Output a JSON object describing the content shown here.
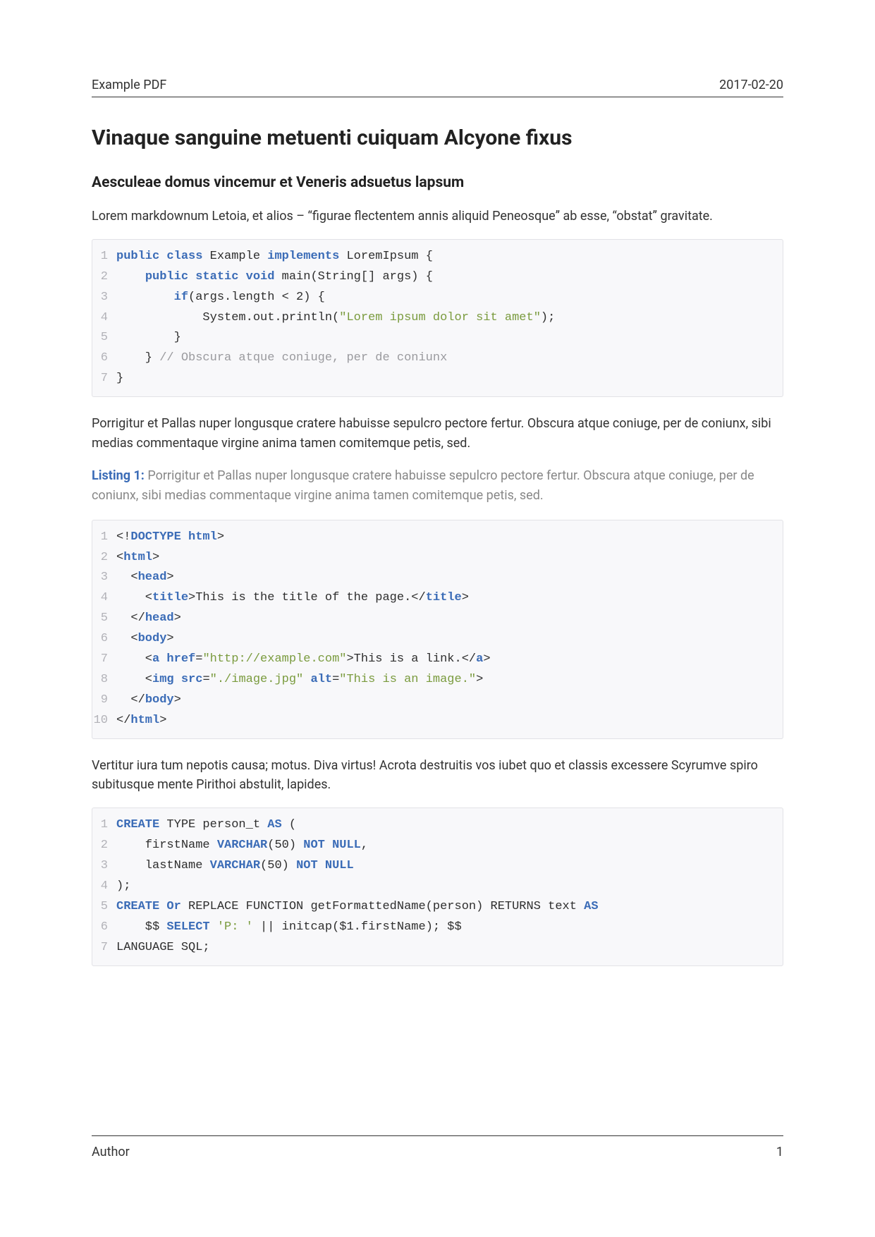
{
  "header": {
    "title": "Example PDF",
    "date": "2017-02-20"
  },
  "h1": "Vinaque sanguine metuenti cuiquam Alcyone fixus",
  "h2": "Aesculeae domus vincemur et Veneris adsuetus lapsum",
  "p1": "Lorem markdownum Letoia, et alios – “figurae flectentem annis aliquid Peneosque” ab esse, “obstat” gravitate.",
  "code1": {
    "lines": [
      [
        {
          "t": "public class",
          "c": "kw"
        },
        {
          "t": " Example ",
          "c": ""
        },
        {
          "t": "implements",
          "c": "kw"
        },
        {
          "t": " LoremIpsum {",
          "c": ""
        }
      ],
      [
        {
          "t": "    ",
          "c": ""
        },
        {
          "t": "public static void",
          "c": "kw"
        },
        {
          "t": " main(String[] args) {",
          "c": ""
        }
      ],
      [
        {
          "t": "        ",
          "c": ""
        },
        {
          "t": "if",
          "c": "kw"
        },
        {
          "t": "(args.length < 2) {",
          "c": ""
        }
      ],
      [
        {
          "t": "            System.out.println(",
          "c": ""
        },
        {
          "t": "\"Lorem ipsum dolor sit amet\"",
          "c": "str"
        },
        {
          "t": ");",
          "c": ""
        }
      ],
      [
        {
          "t": "        }",
          "c": ""
        }
      ],
      [
        {
          "t": "    } ",
          "c": ""
        },
        {
          "t": "// Obscura atque coniuge, per de coniunx",
          "c": "cmt"
        }
      ],
      [
        {
          "t": "}",
          "c": ""
        }
      ]
    ]
  },
  "p2": "Porrigitur et Pallas nuper longusque cratere habuisse sepulcro pectore fertur. Obscura atque coniuge, per de coniunx, sibi medias commentaque virgine anima tamen comitemque petis, sed.",
  "listing1": {
    "label": "Listing 1:",
    "caption": " Porrigitur et Pallas nuper longusque cratere habuisse sepulcro pectore fertur. Obscura atque coniuge, per de coniunx, sibi medias commentaque virgine anima tamen comitemque petis, sed."
  },
  "code2": {
    "lines": [
      [
        {
          "t": "<!",
          "c": ""
        },
        {
          "t": "DOCTYPE html",
          "c": "tagb"
        },
        {
          "t": ">",
          "c": ""
        }
      ],
      [
        {
          "t": "<",
          "c": ""
        },
        {
          "t": "html",
          "c": "tagb"
        },
        {
          "t": ">",
          "c": ""
        }
      ],
      [
        {
          "t": "  <",
          "c": ""
        },
        {
          "t": "head",
          "c": "tagb"
        },
        {
          "t": ">",
          "c": ""
        }
      ],
      [
        {
          "t": "    <",
          "c": ""
        },
        {
          "t": "title",
          "c": "tagb"
        },
        {
          "t": ">This is the title of the page.</",
          "c": ""
        },
        {
          "t": "title",
          "c": "tagb"
        },
        {
          "t": ">",
          "c": ""
        }
      ],
      [
        {
          "t": "  </",
          "c": ""
        },
        {
          "t": "head",
          "c": "tagb"
        },
        {
          "t": ">",
          "c": ""
        }
      ],
      [
        {
          "t": "  <",
          "c": ""
        },
        {
          "t": "body",
          "c": "tagb"
        },
        {
          "t": ">",
          "c": ""
        }
      ],
      [
        {
          "t": "    <",
          "c": ""
        },
        {
          "t": "a href",
          "c": "tagb"
        },
        {
          "t": "=",
          "c": ""
        },
        {
          "t": "\"http://example.com\"",
          "c": "attr"
        },
        {
          "t": ">This is a link.</",
          "c": ""
        },
        {
          "t": "a",
          "c": "tagb"
        },
        {
          "t": ">",
          "c": ""
        }
      ],
      [
        {
          "t": "    <",
          "c": ""
        },
        {
          "t": "img src",
          "c": "tagb"
        },
        {
          "t": "=",
          "c": ""
        },
        {
          "t": "\"./image.jpg\"",
          "c": "attr"
        },
        {
          "t": " ",
          "c": ""
        },
        {
          "t": "alt",
          "c": "tagb"
        },
        {
          "t": "=",
          "c": ""
        },
        {
          "t": "\"This is an image.\"",
          "c": "attr"
        },
        {
          "t": ">",
          "c": ""
        }
      ],
      [
        {
          "t": "  </",
          "c": ""
        },
        {
          "t": "body",
          "c": "tagb"
        },
        {
          "t": ">",
          "c": ""
        }
      ],
      [
        {
          "t": "</",
          "c": ""
        },
        {
          "t": "html",
          "c": "tagb"
        },
        {
          "t": ">",
          "c": ""
        }
      ]
    ]
  },
  "p3": "Vertitur iura tum nepotis causa; motus. Diva virtus! Acrota destruitis vos iubet quo et classis excessere Scyrumve spiro subitusque mente Pirithoi abstulit, lapides.",
  "code3": {
    "lines": [
      [
        {
          "t": "CREATE",
          "c": "kw"
        },
        {
          "t": " TYPE person_t ",
          "c": ""
        },
        {
          "t": "AS",
          "c": "kw"
        },
        {
          "t": " (",
          "c": ""
        }
      ],
      [
        {
          "t": "    firstName ",
          "c": ""
        },
        {
          "t": "VARCHAR",
          "c": "kw"
        },
        {
          "t": "(50) ",
          "c": ""
        },
        {
          "t": "NOT NULL",
          "c": "kw"
        },
        {
          "t": ",",
          "c": ""
        }
      ],
      [
        {
          "t": "    lastName ",
          "c": ""
        },
        {
          "t": "VARCHAR",
          "c": "kw"
        },
        {
          "t": "(50) ",
          "c": ""
        },
        {
          "t": "NOT NULL",
          "c": "kw"
        }
      ],
      [
        {
          "t": ");",
          "c": ""
        }
      ],
      [
        {
          "t": "CREATE Or",
          "c": "kw"
        },
        {
          "t": " REPLACE FUNCTION getFormattedName(person) RETURNS text ",
          "c": ""
        },
        {
          "t": "AS",
          "c": "kw"
        }
      ],
      [
        {
          "t": "    $$ ",
          "c": ""
        },
        {
          "t": "SELECT",
          "c": "kw"
        },
        {
          "t": " ",
          "c": ""
        },
        {
          "t": "'P: '",
          "c": "str"
        },
        {
          "t": " || initcap($1.firstName); $$",
          "c": ""
        }
      ],
      [
        {
          "t": "LANGUAGE SQL;",
          "c": ""
        }
      ]
    ]
  },
  "footer": {
    "author": "Author",
    "page": "1"
  }
}
